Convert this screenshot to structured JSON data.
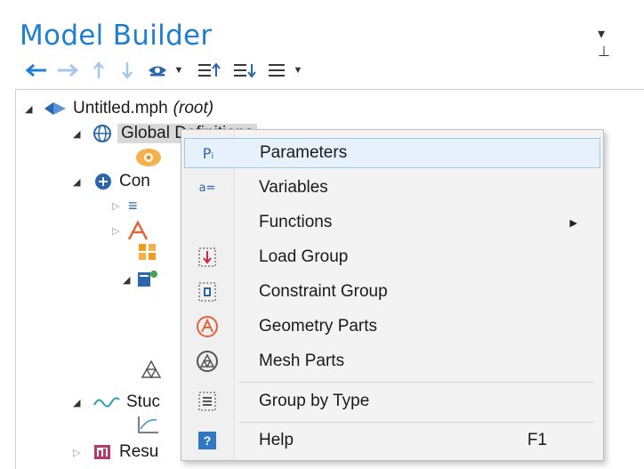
{
  "panel": {
    "title": "Model Builder",
    "pin_glyph": "▾",
    "close_glyph": "⊥"
  },
  "toolbar": {
    "back_icon": "arrow-left",
    "forward_icon": "arrow-right",
    "up_icon": "arrow-up",
    "down_icon": "arrow-down",
    "show_icon": "eye",
    "expand_icon": "expand-sections",
    "collapse_icon": "collapse-sections",
    "list_icon": "list"
  },
  "tree": {
    "root_label": "Untitled.mph",
    "root_suffix": "(root)",
    "global_label": "Global Definitions",
    "component_label": "Con",
    "study_label": "Stuc",
    "results_label": "Resu"
  },
  "menu": {
    "items": [
      {
        "label": "Parameters",
        "icon": "Pᵢ"
      },
      {
        "label": "Variables",
        "icon": "a="
      },
      {
        "label": "Functions"
      },
      {
        "label": "Load Group"
      },
      {
        "label": "Constraint Group"
      },
      {
        "label": "Geometry Parts"
      },
      {
        "label": "Mesh Parts"
      },
      {
        "label": "Group by Type"
      },
      {
        "label": "Help",
        "icon": "?",
        "shortcut": "F1"
      }
    ]
  },
  "colors": {
    "title_blue": "#1e7fd3",
    "highlight": "#e6f1fb",
    "highlight_border": "#9ec9ee",
    "geometry_orange": "#e0643c",
    "help_blue": "#2f78c4"
  }
}
